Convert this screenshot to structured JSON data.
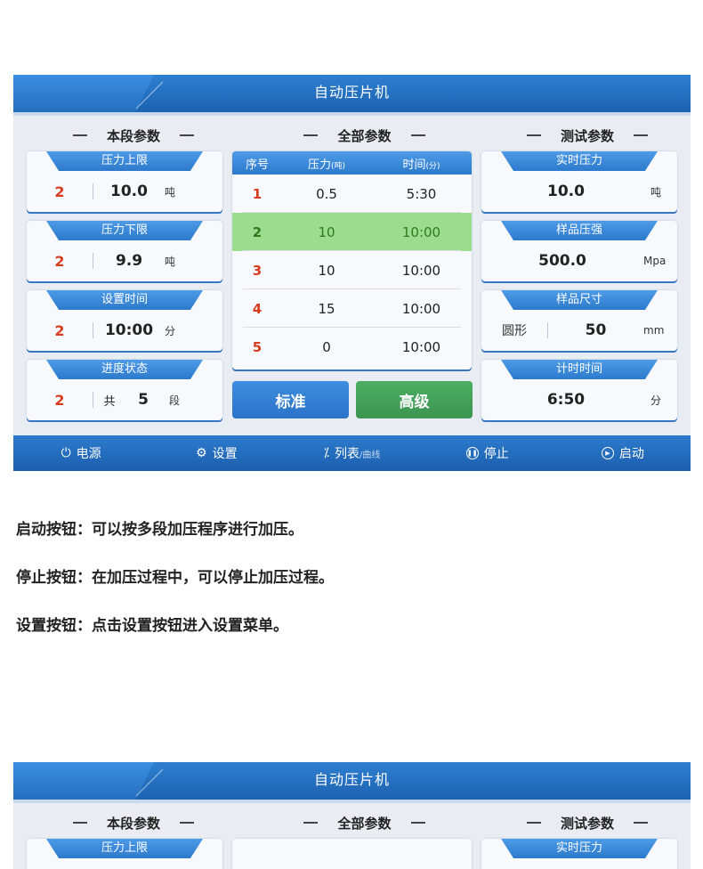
{
  "app_title": "自动压片机",
  "sections": {
    "current": "本段参数",
    "all": "全部参数",
    "test": "测试参数"
  },
  "left_cards": [
    {
      "caption": "压力上限",
      "index": "2",
      "value": "10.0",
      "unit": "吨"
    },
    {
      "caption": "压力下限",
      "index": "2",
      "value": "9.9",
      "unit": "吨"
    },
    {
      "caption": "设置时间",
      "index": "2",
      "value": "10:00",
      "unit": "分"
    },
    {
      "caption": "进度状态",
      "index": "2",
      "pre": "共",
      "value": "5",
      "unit": "段"
    }
  ],
  "table": {
    "headers": {
      "seq": "序号",
      "pressure": "压力",
      "pressure_unit": "(吨)",
      "time": "时间",
      "time_unit": "(分)"
    },
    "rows": [
      {
        "seq": "1",
        "pressure": "0.5",
        "time": "5:30"
      },
      {
        "seq": "2",
        "pressure": "10",
        "time": "10:00"
      },
      {
        "seq": "3",
        "pressure": "10",
        "time": "10:00"
      },
      {
        "seq": "4",
        "pressure": "15",
        "time": "10:00"
      },
      {
        "seq": "5",
        "pressure": "0",
        "time": "10:00"
      }
    ],
    "selected_row": 2
  },
  "buttons": {
    "standard": "标准",
    "advanced": "高级"
  },
  "right_cards": [
    {
      "caption": "实时压力",
      "value": "10.0",
      "unit": "吨"
    },
    {
      "caption": "样品压强",
      "value": "500.0",
      "unit": "Mpa"
    },
    {
      "caption": "样品尺寸",
      "shape": "圆形",
      "value": "50",
      "unit": "mm"
    },
    {
      "caption": "计时时间",
      "value": "6:50",
      "unit": "分"
    }
  ],
  "bottom_bar": {
    "power": "电源",
    "settings": "设置",
    "list": "列表",
    "curve": "/曲线",
    "stop": "停止",
    "start": "启动"
  },
  "icons": [
    "power-icon",
    "gear-icon",
    "list-icon",
    "pause-icon",
    "play-icon"
  ],
  "descriptions": [
    "启动按钮：可以按多段加压程序进行加压。",
    "停止按钮：在加压过程中，可以停止加压过程。",
    "设置按钮：点击设置按钮进入设置菜单。"
  ],
  "preview_cards": {
    "left": "压力上限",
    "right": "实时压力"
  },
  "colors": {
    "accent_blue": "#2a73c8",
    "highlight_green": "#9bdc8e",
    "index_red": "#d63c1e"
  }
}
